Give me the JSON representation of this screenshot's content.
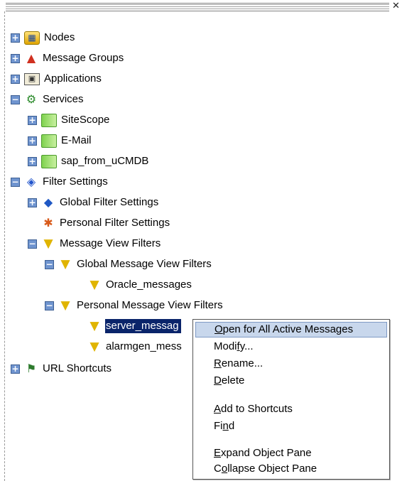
{
  "window": {
    "close_glyph": "✕"
  },
  "tree": {
    "nodes": {
      "label": "Nodes",
      "icon": "nodes-icon"
    },
    "message_groups": {
      "label": "Message Groups",
      "icon": "message-groups-icon"
    },
    "applications": {
      "label": "Applications",
      "icon": "applications-icon"
    },
    "services": {
      "label": "Services",
      "icon": "services-icon",
      "children": [
        {
          "label": "SiteScope",
          "icon": "service-icon"
        },
        {
          "label": "E-Mail",
          "icon": "service-icon"
        },
        {
          "label": "sap_from_uCMDB",
          "icon": "service-icon"
        }
      ]
    },
    "filter_settings": {
      "label": "Filter Settings",
      "icon": "filter-settings-icon",
      "global_filter_settings": "Global Filter Settings",
      "personal_filter_settings": "Personal Filter Settings",
      "message_view_filters": {
        "label": "Message View Filters",
        "global": {
          "label": "Global Message View Filters",
          "items": [
            "Oracle_messages"
          ]
        },
        "personal": {
          "label": "Personal Message View Filters",
          "items": [
            "server_messag",
            "alarmgen_mess"
          ],
          "selected": "server_messag"
        }
      }
    },
    "url_shortcuts": {
      "label": "URL Shortcuts",
      "icon": "url-shortcuts-icon"
    },
    "expander_collapsed": "+",
    "expander_expanded": "−"
  },
  "context_menu": {
    "items": [
      {
        "pre": "",
        "key": "O",
        "post": "pen for All Active Messages",
        "highlighted": true
      },
      {
        "pre": "Modi",
        "key": "f",
        "post": "y...",
        "highlighted": false
      },
      {
        "pre": "",
        "key": "R",
        "post": "ename...",
        "highlighted": false
      },
      {
        "pre": "",
        "key": "D",
        "post": "elete",
        "highlighted": false
      },
      {
        "pre": "",
        "key": "A",
        "post": "dd to Shortcuts",
        "highlighted": false
      },
      {
        "pre": "Fi",
        "key": "n",
        "post": "d",
        "highlighted": false
      },
      {
        "pre": "",
        "key": "E",
        "post": "xpand Object Pane",
        "highlighted": false
      },
      {
        "pre": "C",
        "key": "o",
        "post": "llapse Object Pane",
        "highlighted": false
      }
    ]
  },
  "colors": {
    "selection": "#0a246a",
    "menu_highlight": "#c8d7ec",
    "expander": "#6f94cf"
  }
}
